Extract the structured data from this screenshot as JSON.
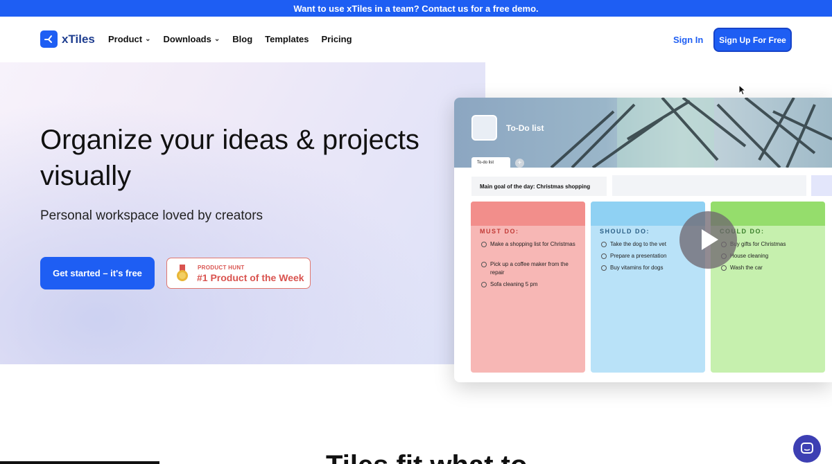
{
  "banner": {
    "text": "Want to use xTiles in a team? Contact us for a free demo."
  },
  "nav": {
    "logo": "xTiles",
    "items": [
      {
        "label": "Product",
        "has_dropdown": true
      },
      {
        "label": "Downloads",
        "has_dropdown": true
      },
      {
        "label": "Blog",
        "has_dropdown": false
      },
      {
        "label": "Templates",
        "has_dropdown": false
      },
      {
        "label": "Pricing",
        "has_dropdown": false
      }
    ],
    "sign_in": "Sign In",
    "sign_up": "Sign Up For Free"
  },
  "hero": {
    "title_line1": "Organize your ideas & projects",
    "title_line2": "visually",
    "subtitle": "Personal workspace loved by creators",
    "cta": "Get started – it's free",
    "badge_small": "PRODUCT HUNT",
    "badge_big": "#1 Product of the Week"
  },
  "preview": {
    "doc_title": "To-Do list",
    "tab_label": "To-do list",
    "goal": "Main goal of the day: Christmas shopping",
    "columns": [
      {
        "label": "MUST DO:",
        "tasks": [
          "Make a shopping list for Christmas",
          "Pick up a coffee maker from the repair",
          "Sofa cleaning 5 pm"
        ]
      },
      {
        "label": "SHOULD DO:",
        "tasks": [
          "Take the dog to the vet",
          "Prepare a presentation",
          "Buy vitamins for dogs"
        ]
      },
      {
        "label": "COULD DO:",
        "tasks": [
          "Buy gifts for Christmas",
          "House cleaning",
          "Wash the car"
        ]
      }
    ]
  },
  "bottom": {
    "heading": "Tiles fit what to"
  },
  "colors": {
    "brand": "#1e5ef3",
    "badge": "#d9534f"
  }
}
